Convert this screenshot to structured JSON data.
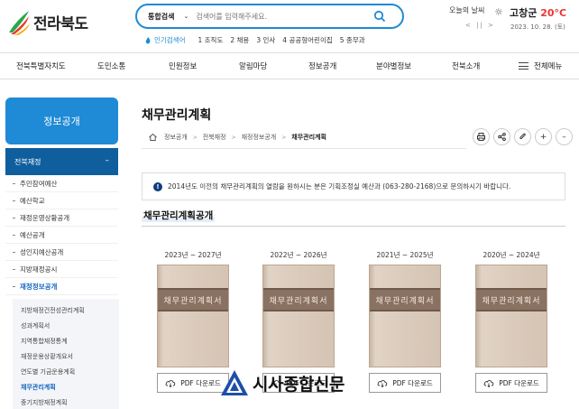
{
  "brand": {
    "logo_text": "전라북도"
  },
  "search": {
    "type_label": "통합검색",
    "placeholder": "검색어를 입력해주세요."
  },
  "popular": {
    "label": "인기검색어",
    "keywords": [
      "1 조직도",
      "2 채용",
      "3 인사",
      "4 공공형어린이집",
      "5 종무과"
    ]
  },
  "weather": {
    "label": "오늘의 날씨",
    "location": "고창군",
    "temperature": "20°C",
    "controls": "< || >",
    "date": "2023. 10. 28. (토)"
  },
  "nav": {
    "items": [
      "전북특별자치도",
      "도민소통",
      "민원정보",
      "알림마당",
      "정보공개",
      "분야별정보",
      "전북소개"
    ],
    "all_menu": "전체메뉴"
  },
  "sidebar": {
    "title": "정보공개",
    "section": "전북재정",
    "items": [
      "주민참여예산",
      "예산학교",
      "재정운영상황공개",
      "예산공개",
      "성인지예산공개",
      "지방재정공시",
      "재정정보공개"
    ],
    "active_index": 6,
    "sub_items": [
      "지방재정건전성관리계획",
      "성과계획서",
      "지역통합재정통계",
      "재정운용상황개요서",
      "연도별 기금운용계획",
      "채무관리계획",
      "중기지방재정계획"
    ],
    "sub_active_index": 5
  },
  "page": {
    "title": "채무관리계획",
    "breadcrumb": [
      "홈",
      "정보공개",
      "전북재정",
      "재정정보공개",
      "채무관리계획"
    ],
    "notice": "2014년도 이전의 채무관리계획의 열람을 원하시는 분은 기획조정실 예산과 (063-280-2168)으로 문의하시기 바랍니다.",
    "section_title": "채무관리계획공개"
  },
  "books": [
    {
      "years": "2023년 ~ 2027년",
      "cover_title": "채무관리계획서",
      "button": "PDF 다운로드"
    },
    {
      "years": "2022년 ~ 2026년",
      "cover_title": "채무관리계획서",
      "button": "PDF 다운로드"
    },
    {
      "years": "2021년 ~ 2025년",
      "cover_title": "채무관리계획서",
      "button": "PDF 다운로드"
    },
    {
      "years": "2020년 ~ 2024년",
      "cover_title": "채무관리계획서",
      "button": "PDF 다운로드"
    }
  ],
  "watermark": {
    "text": "시사종합신문"
  },
  "colors": {
    "accent": "#1f8ad6",
    "sidebar_section": "#0f5e9e",
    "temperature": "#e33333",
    "active_link": "#1565c0"
  },
  "icons": [
    "logo-mark",
    "search-icon",
    "flame-icon",
    "sun-icon",
    "bars-icon",
    "home-icon",
    "print-icon",
    "share-icon",
    "clip-icon",
    "plus-icon",
    "minus-icon",
    "info-icon",
    "cloud-download-icon",
    "watermark-logo"
  ]
}
